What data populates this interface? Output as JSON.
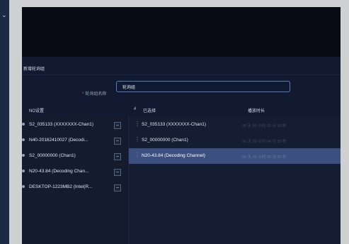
{
  "sidebar": {
    "icon": "chevron-right-icon",
    "glyph": "⌄"
  },
  "dialog": {
    "title": "新增轮询组",
    "name_label": "轮询组名称",
    "name_value": "轮询组"
  },
  "left_list": {
    "header": "NO设置",
    "items": [
      {
        "label": "S2_035133 (XXXXXXX-Chan1)"
      },
      {
        "label": "N40-20162410027 (Decodi..."
      },
      {
        "label": "S2_00000000 (Chan1)"
      },
      {
        "label": "N20-43.84 (Decoding Chan..."
      },
      {
        "label": "DESKTOP-1223MB2 (Intel(R..."
      }
    ]
  },
  "right_list": {
    "header_sort": "#",
    "header_selected": "已选择",
    "header_time": "播放时长",
    "items": [
      {
        "label": "S2_035133 (XXXXXXX-Chan1)",
        "time": "00 天 00 小时 01 分 30 秒"
      },
      {
        "label": "S2_00000000 (Chan1)",
        "time": "00 天 00 小时 04 分 30 秒"
      },
      {
        "label": "N20-43.84 (Decoding Channel)",
        "time": "00 天 00 小时 00 分 30 秒"
      }
    ]
  }
}
